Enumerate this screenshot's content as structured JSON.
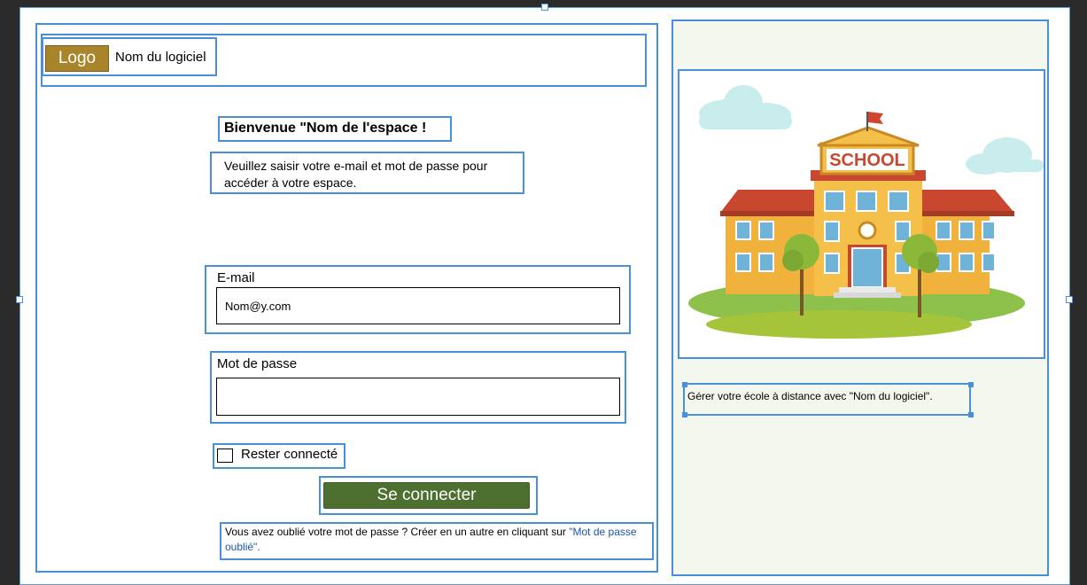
{
  "header": {
    "logo_label": "Logo",
    "app_name": "Nom du logiciel"
  },
  "login": {
    "welcome": "Bienvenue \"Nom de l'espace !",
    "instructions": "Veuillez saisir votre e-mail et mot de passe pour accéder à votre espace.",
    "email_label": "E-mail",
    "email_value": "Nom@y.com",
    "password_label": "Mot de passe",
    "password_value": "",
    "remember_label": "Rester connecté",
    "remember_checked": false,
    "submit_label": "Se connecter",
    "forgot_text": "Vous avez oublié votre mot de passe ? Créer en un autre en  cliquant sur ",
    "forgot_link": "\"Mot de passe oublié\"."
  },
  "side": {
    "illustration_sign": "SCHOOL",
    "tagline": "Gérer votre école à distance avec \"Nom du logiciel\"."
  },
  "colors": {
    "logo_bg": "#a8852a",
    "button_bg": "#4d6f2f",
    "wireframe_border": "#4a90d9",
    "side_bg": "#f4f7ee",
    "link": "#1a56a8"
  }
}
